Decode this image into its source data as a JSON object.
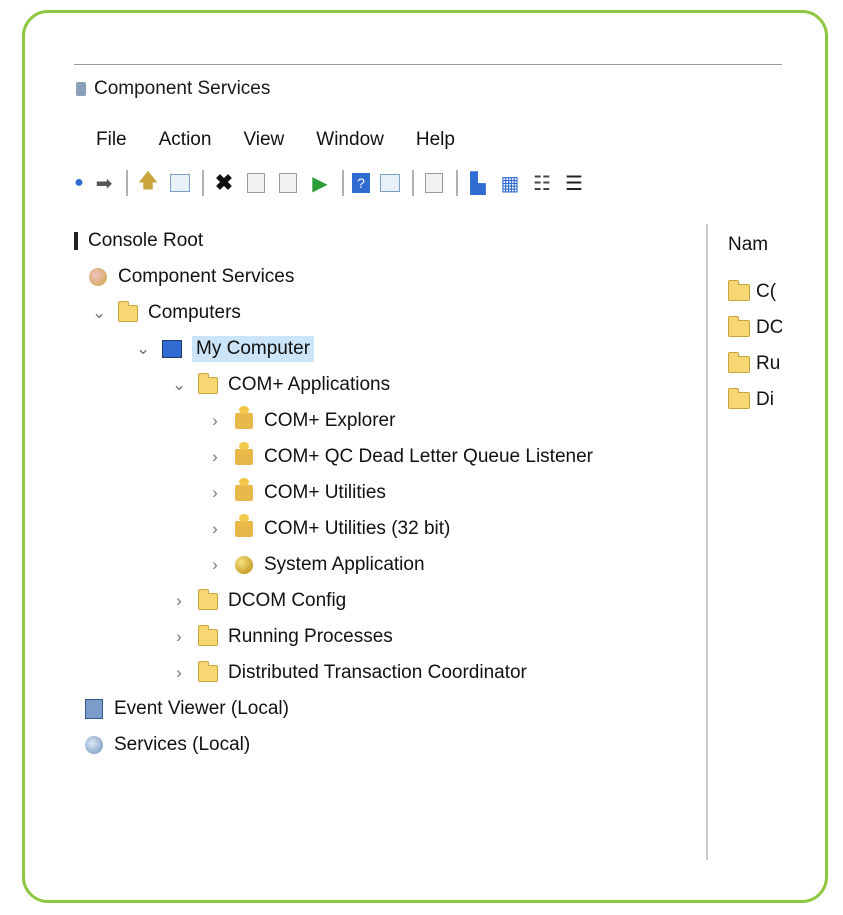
{
  "window": {
    "title": "Component Services"
  },
  "menu": {
    "items": [
      "File",
      "Action",
      "View",
      "Window",
      "Help"
    ]
  },
  "toolbar": {
    "buttons": [
      "back-icon",
      "forward-icon",
      "up-level-icon",
      "show-hide-tree-icon",
      "delete-icon",
      "properties-icon",
      "refresh-icon",
      "export-icon",
      "help-icon",
      "show-hide-action-pane-icon",
      "new-window-icon",
      "large-icons-view-icon",
      "small-icons-view-icon",
      "list-view-icon",
      "detail-view-icon"
    ]
  },
  "tree": {
    "nodes": [
      {
        "label": "Console Root",
        "icon": "folder-icon"
      },
      {
        "label": "Component Services",
        "icon": "component-services-icon"
      },
      {
        "label": "Computers",
        "icon": "folder-icon",
        "expanded": true
      },
      {
        "label": "My Computer",
        "icon": "computer-icon",
        "expanded": true,
        "selected": true
      },
      {
        "label": "COM+ Applications",
        "icon": "folder-icon",
        "expanded": true
      },
      {
        "label": "COM+ Explorer",
        "icon": "com-app-icon"
      },
      {
        "label": "COM+ QC Dead Letter Queue Listener",
        "icon": "com-app-icon"
      },
      {
        "label": "COM+ Utilities",
        "icon": "com-app-icon"
      },
      {
        "label": "COM+ Utilities (32 bit)",
        "icon": "com-app-icon"
      },
      {
        "label": "System Application",
        "icon": "system-application-icon"
      },
      {
        "label": "DCOM Config",
        "icon": "folder-icon"
      },
      {
        "label": "Running Processes",
        "icon": "folder-icon"
      },
      {
        "label": "Distributed Transaction Coordinator",
        "icon": "folder-icon"
      },
      {
        "label": "Event Viewer (Local)",
        "icon": "event-viewer-icon"
      },
      {
        "label": "Services (Local)",
        "icon": "services-icon"
      }
    ]
  },
  "right_pane": {
    "header": "Nam",
    "items": [
      "C(",
      "DC",
      "Ru",
      "Di"
    ]
  }
}
